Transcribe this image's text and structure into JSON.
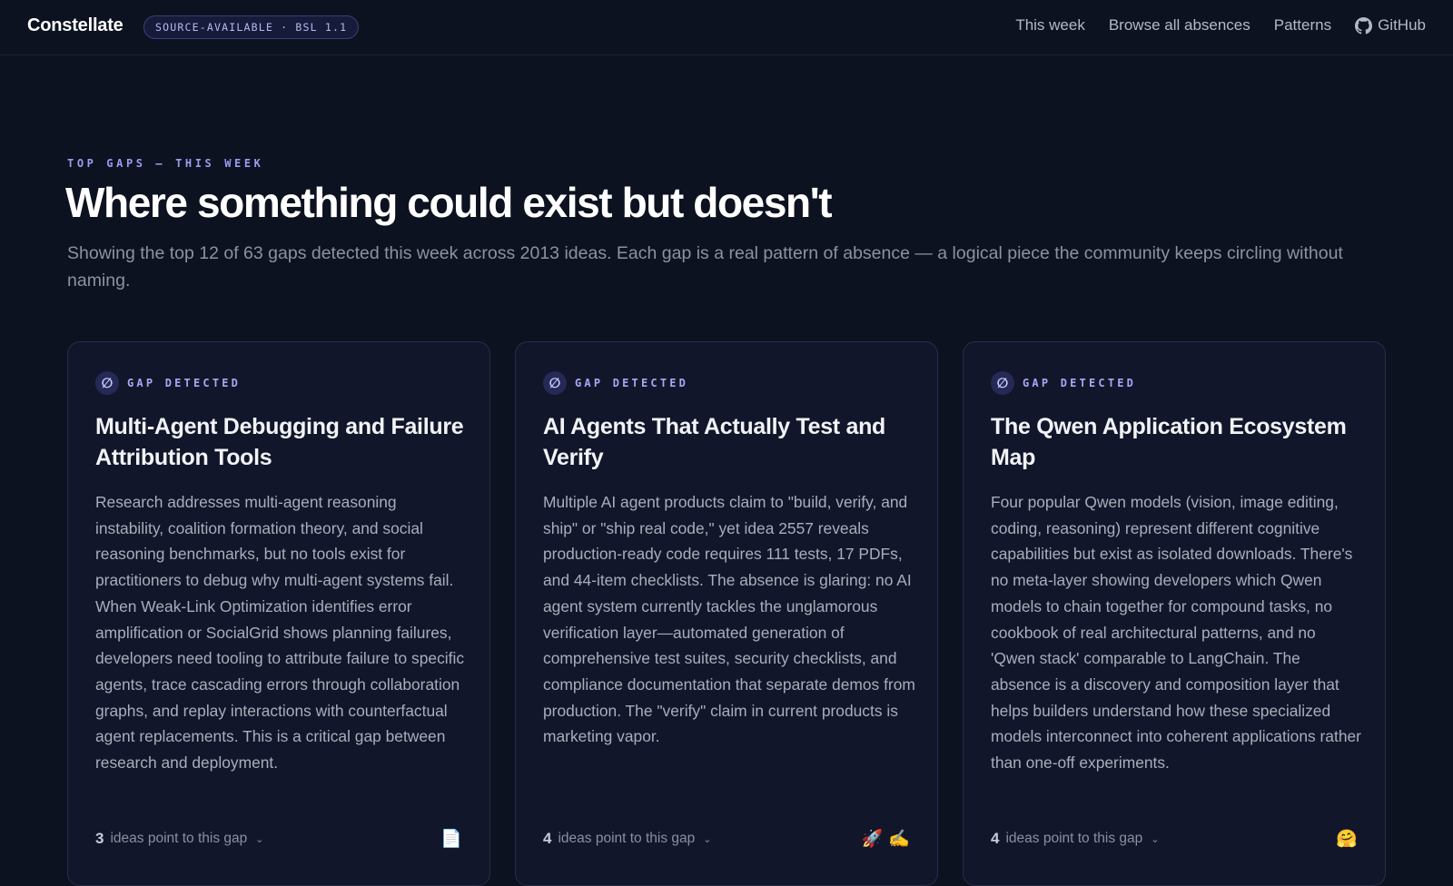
{
  "header": {
    "brand": "Constellate",
    "license_badge": "SOURCE-AVAILABLE · BSL 1.1",
    "nav": {
      "this_week": "This week",
      "browse": "Browse all absences",
      "patterns": "Patterns",
      "github": "GitHub"
    }
  },
  "hero": {
    "eyebrow": "TOP GAPS — THIS WEEK",
    "title": "Where something could exist but doesn't",
    "subtitle": "Showing the top 12 of 63 gaps detected this week across 2013 ideas. Each gap is a real pattern of absence — a logical piece the community keeps circling without naming."
  },
  "cards": [
    {
      "tag_icon": "∅",
      "tag": "GAP DETECTED",
      "title": "Multi-Agent Debugging and Failure Attribution Tools",
      "body": "Research addresses multi-agent reasoning instability, coalition formation theory, and social reasoning benchmarks, but no tools exist for practitioners to debug why multi-agent systems fail. When Weak-Link Optimization identifies error amplification or SocialGrid shows planning failures, developers need tooling to attribute failure to specific agents, trace cascading errors through collaboration graphs, and replay interactions with counterfactual agent replacements. This is a critical gap between research and deployment.",
      "ideas_count": "3",
      "ideas_label": "ideas point to this gap",
      "emojis": [
        "📄"
      ]
    },
    {
      "tag_icon": "∅",
      "tag": "GAP DETECTED",
      "title": "AI Agents That Actually Test and Verify",
      "body": "Multiple AI agent products claim to \"build, verify, and ship\" or \"ship real code,\" yet idea 2557 reveals production-ready code requires 111 tests, 17 PDFs, and 44-item checklists. The absence is glaring: no AI agent system currently tackles the unglamorous verification layer—automated generation of comprehensive test suites, security checklists, and compliance documentation that separate demos from production. The \"verify\" claim in current products is marketing vapor.",
      "ideas_count": "4",
      "ideas_label": "ideas point to this gap",
      "emojis": [
        "🚀",
        "✍️"
      ]
    },
    {
      "tag_icon": "∅",
      "tag": "GAP DETECTED",
      "title": "The Qwen Application Ecosystem Map",
      "body": "Four popular Qwen models (vision, image editing, coding, reasoning) represent different cognitive capabilities but exist as isolated downloads. There's no meta-layer showing developers which Qwen models to chain together for compound tasks, no cookbook of real architectural patterns, and no 'Qwen stack' comparable to LangChain. The absence is a discovery and composition layer that helps builders understand how these specialized models interconnect into coherent applications rather than one-off experiments.",
      "ideas_count": "4",
      "ideas_label": "ideas point to this gap",
      "emojis": [
        "🤗"
      ]
    }
  ],
  "icons": {
    "github": "github-icon",
    "chevron": "chevron-down-icon",
    "tag": "empty-set-icon"
  },
  "colors": {
    "background": "#0d1220",
    "card_background": "#11162a",
    "accent": "#9a9cf2",
    "badge_bg": "#171b3a"
  }
}
